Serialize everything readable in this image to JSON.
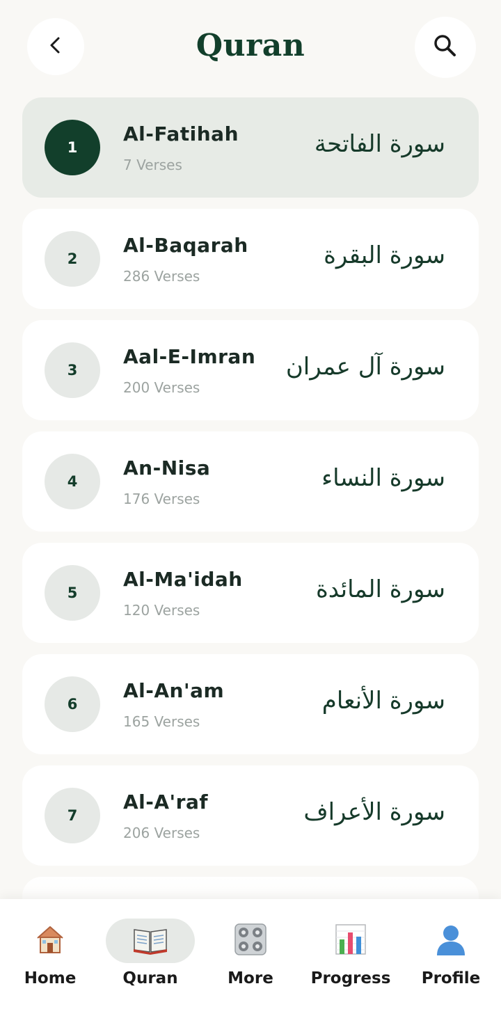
{
  "header": {
    "title": "Quran",
    "back_icon": "chevron-left-icon",
    "search_icon": "search-icon"
  },
  "surahs": [
    {
      "number": "1",
      "name": "Al-Fatihah",
      "verses": "7 Verses",
      "arabic": "سورة الفاتحة",
      "selected": true
    },
    {
      "number": "2",
      "name": "Al-Baqarah",
      "verses": "286 Verses",
      "arabic": "سورة البقرة",
      "selected": false
    },
    {
      "number": "3",
      "name": "Aal-E-Imran",
      "verses": "200 Verses",
      "arabic": "سورة آل عمران",
      "selected": false
    },
    {
      "number": "4",
      "name": "An-Nisa",
      "verses": "176 Verses",
      "arabic": "سورة النساء",
      "selected": false
    },
    {
      "number": "5",
      "name": "Al-Ma'idah",
      "verses": "120 Verses",
      "arabic": "سورة المائدة",
      "selected": false
    },
    {
      "number": "6",
      "name": "Al-An'am",
      "verses": "165 Verses",
      "arabic": "سورة الأنعام",
      "selected": false
    },
    {
      "number": "7",
      "name": "Al-A'raf",
      "verses": "206 Verses",
      "arabic": "سورة الأعراف",
      "selected": false
    }
  ],
  "nav": {
    "items": [
      {
        "label": "Home",
        "icon": "house-icon",
        "active": false
      },
      {
        "label": "Quran",
        "icon": "open-book-icon",
        "active": true
      },
      {
        "label": "More",
        "icon": "grid-dots-icon",
        "active": false
      },
      {
        "label": "Progress",
        "icon": "bar-chart-icon",
        "active": false
      },
      {
        "label": "Profile",
        "icon": "person-icon",
        "active": false
      }
    ]
  },
  "colors": {
    "background": "#f9f8f5",
    "primary": "#123f2b",
    "selected_card": "#e7ebe6",
    "number_circle": "#e6e9e6",
    "muted_text": "#9ca3a0"
  }
}
